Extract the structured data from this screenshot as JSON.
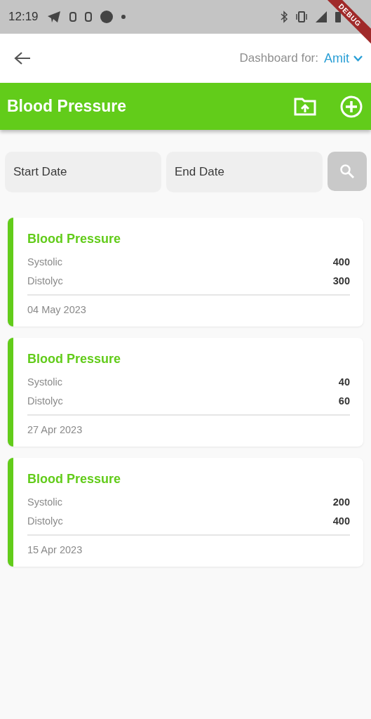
{
  "status_bar": {
    "time": "12:19"
  },
  "debug_banner": {
    "label": "DEBUG"
  },
  "top_bar": {
    "dashboard_label": "Dashboard for:",
    "user": "Amit"
  },
  "header": {
    "title": "Blood Pressure"
  },
  "filters": {
    "start": {
      "placeholder": "Start Date"
    },
    "end": {
      "placeholder": "End Date"
    }
  },
  "records": [
    {
      "title": "Blood Pressure",
      "rows": [
        {
          "label": "Systolic",
          "value": "400"
        },
        {
          "label": "Distolyc",
          "value": "300"
        }
      ],
      "date": "04 May 2023"
    },
    {
      "title": "Blood Pressure",
      "rows": [
        {
          "label": "Systolic",
          "value": "40"
        },
        {
          "label": "Distolyc",
          "value": "60"
        }
      ],
      "date": "27 Apr 2023"
    },
    {
      "title": "Blood Pressure",
      "rows": [
        {
          "label": "Systolic",
          "value": "200"
        },
        {
          "label": "Distolyc",
          "value": "400"
        }
      ],
      "date": "15 Apr 2023"
    }
  ]
}
